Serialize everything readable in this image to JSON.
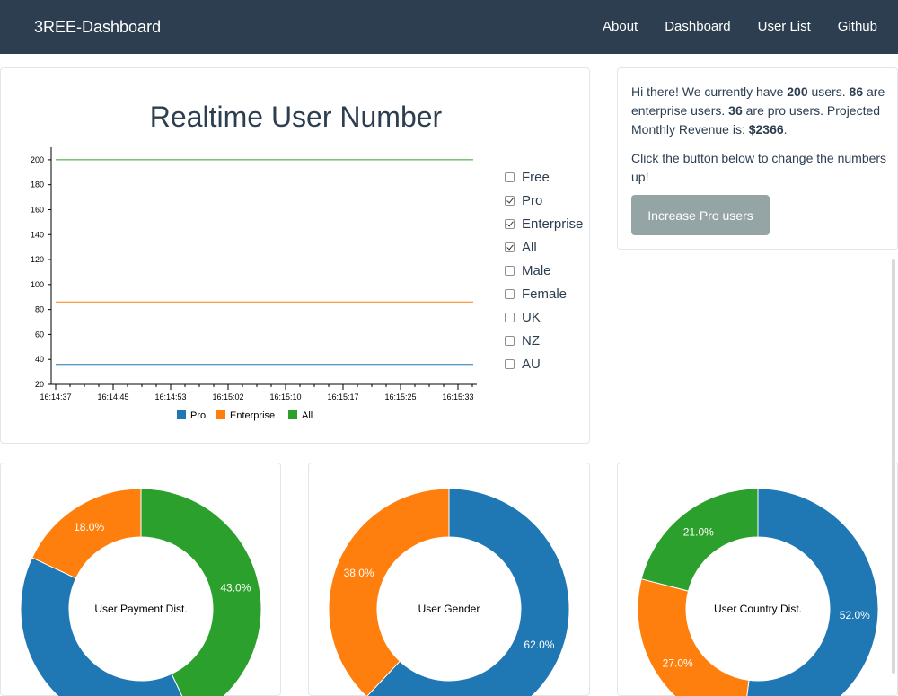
{
  "navbar": {
    "brand": "3REE-Dashboard",
    "links": [
      "About",
      "Dashboard",
      "User List",
      "Github"
    ]
  },
  "realtime": {
    "title": "Realtime User Number",
    "filters": [
      {
        "label": "Free",
        "checked": false
      },
      {
        "label": "Pro",
        "checked": true
      },
      {
        "label": "Enterprise",
        "checked": true
      },
      {
        "label": "All",
        "checked": true
      },
      {
        "label": "Male",
        "checked": false
      },
      {
        "label": "Female",
        "checked": false
      },
      {
        "label": "UK",
        "checked": false
      },
      {
        "label": "NZ",
        "checked": false
      },
      {
        "label": "AU",
        "checked": false
      }
    ]
  },
  "info": {
    "greeting_pre": "Hi there! We currently have ",
    "total_users": "200",
    "greeting_mid1": " users. ",
    "enterprise_users": "86",
    "greeting_mid2": " are enterprise users. ",
    "pro_users": "36",
    "greeting_mid3": " are pro users. Projected Monthly Revenue is: ",
    "revenue": "$2366",
    "greeting_end": ".",
    "prompt": "Click the button below to change the numbers up!",
    "button_label": "Increase Pro users"
  },
  "colors": {
    "blue": "#1f77b4",
    "orange": "#ff7f0e",
    "green": "#2ca02c"
  },
  "chart_data": [
    {
      "type": "line",
      "title": "Realtime User Number",
      "x": [
        "16:14:37",
        "16:14:45",
        "16:14:53",
        "16:15:02",
        "16:15:10",
        "16:15:17",
        "16:15:25",
        "16:15:33"
      ],
      "ylim": [
        20,
        210
      ],
      "yticks": [
        20,
        40,
        60,
        80,
        100,
        120,
        140,
        160,
        180,
        200
      ],
      "series": [
        {
          "name": "Pro",
          "color": "#1f77b4",
          "values": [
            36,
            36,
            36,
            36,
            36,
            36,
            36,
            36
          ]
        },
        {
          "name": "Enterprise",
          "color": "#ff7f0e",
          "values": [
            86,
            86,
            86,
            86,
            86,
            86,
            86,
            86
          ]
        },
        {
          "name": "All",
          "color": "#2ca02c",
          "values": [
            200,
            200,
            200,
            200,
            200,
            200,
            200,
            200
          ]
        }
      ],
      "legend": "bottom",
      "grid": false
    },
    {
      "type": "pie",
      "title": "User Payment Dist.",
      "slices": [
        {
          "value": 43.0,
          "label": "43.0%",
          "color": "#2ca02c"
        },
        {
          "value": 39.0,
          "label": "",
          "color": "#1f77b4"
        },
        {
          "value": 18.0,
          "label": "18.0%",
          "color": "#ff7f0e"
        }
      ]
    },
    {
      "type": "pie",
      "title": "User Gender",
      "slices": [
        {
          "value": 62.0,
          "label": "62.0%",
          "color": "#1f77b4"
        },
        {
          "value": 38.0,
          "label": "38.0%",
          "color": "#ff7f0e"
        }
      ]
    },
    {
      "type": "pie",
      "title": "User Country Dist.",
      "slices": [
        {
          "value": 52.0,
          "label": "52.0%",
          "color": "#1f77b4"
        },
        {
          "value": 27.0,
          "label": "27.0%",
          "color": "#ff7f0e"
        },
        {
          "value": 21.0,
          "label": "21.0%",
          "color": "#2ca02c"
        }
      ]
    }
  ]
}
